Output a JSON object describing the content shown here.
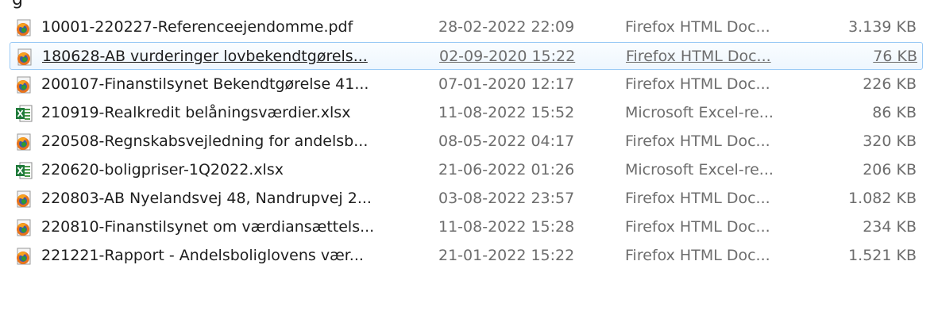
{
  "files": [
    {
      "name": "10001-220227-Referenceejendomme.pdf",
      "date": "28-02-2022 22:09",
      "type": "Firefox HTML Doc...",
      "size": "3.139 KB",
      "icon": "firefox-document-icon"
    },
    {
      "name": "180628-AB vurderinger lovbekendtgørels...",
      "date": "02-09-2020 15:22",
      "type": "Firefox HTML Doc...",
      "size": "76 KB",
      "icon": "firefox-document-icon"
    },
    {
      "name": "200107-Finanstilsynet Bekendtgørelse 41...",
      "date": "07-01-2020 12:17",
      "type": "Firefox HTML Doc...",
      "size": "226 KB",
      "icon": "firefox-document-icon"
    },
    {
      "name": "210919-Realkredit belåningsværdier.xlsx",
      "date": "11-08-2022 15:52",
      "type": "Microsoft Excel-re...",
      "size": "86 KB",
      "icon": "excel-document-icon"
    },
    {
      "name": "220508-Regnskabsvejledning for andelsb...",
      "date": "08-05-2022 04:17",
      "type": "Firefox HTML Doc...",
      "size": "320 KB",
      "icon": "firefox-document-icon"
    },
    {
      "name": "220620-boligpriser-1Q2022.xlsx",
      "date": "21-06-2022 01:26",
      "type": "Microsoft Excel-re...",
      "size": "206 KB",
      "icon": "excel-document-icon"
    },
    {
      "name": "220803-AB Nyelandsvej 48, Nandrupvej 2...",
      "date": "03-08-2022 23:57",
      "type": "Firefox HTML Doc...",
      "size": "1.082 KB",
      "icon": "firefox-document-icon"
    },
    {
      "name": "220810-Finanstilsynet om værdiansættels...",
      "date": "11-08-2022 15:28",
      "type": "Firefox HTML Doc...",
      "size": "234 KB",
      "icon": "firefox-document-icon"
    },
    {
      "name": "221221-Rapport - Andelsboliglovens vær...",
      "date": "21-01-2022 15:22",
      "type": "Firefox HTML Doc...",
      "size": "1.521 KB",
      "icon": "firefox-document-icon"
    }
  ],
  "hovered_row": 1,
  "colors": {
    "hover_border": "#99c9f5",
    "hover_fill": "#eef6fe",
    "name_text": "#1e1e1e",
    "detail_text": "#6d6d6d"
  }
}
